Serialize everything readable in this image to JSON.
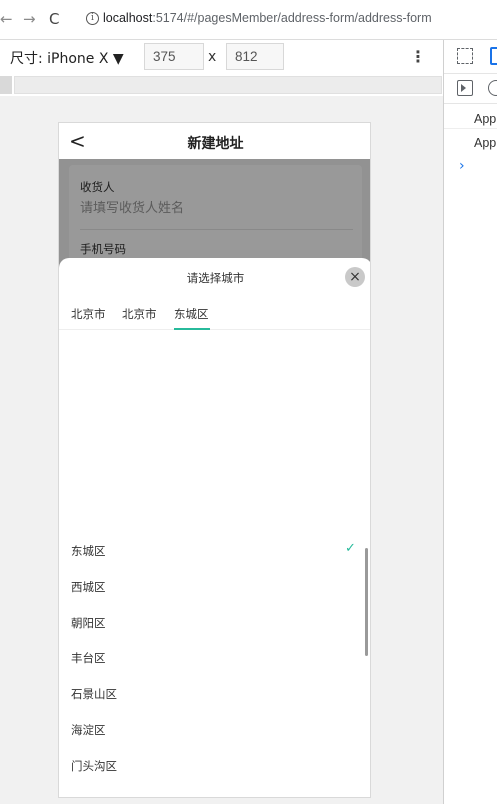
{
  "browser": {
    "back_glyph": "←",
    "forward_glyph": "→",
    "reload_glyph": "C",
    "info_glyph": "i",
    "url_host": "localhost",
    "url_path": ":5174/#/pagesMember/address-form/address-form"
  },
  "device_toolbar": {
    "dimension_label": "尺寸: iPhone X ▼",
    "width": "375",
    "times": "x",
    "height": "812",
    "more_glyph": "⋮"
  },
  "devtools": {
    "rows": [
      "App",
      "App"
    ],
    "expand_glyph": "›"
  },
  "page": {
    "back_glyph": "<",
    "title": "新建地址",
    "form": {
      "receiver_label": "收货人",
      "receiver_placeholder": "请填写收货人姓名",
      "phone_label": "手机号码"
    }
  },
  "city_picker": {
    "title": "请选择城市",
    "close_glyph": "×",
    "tabs": [
      "北京市",
      "北京市",
      "东城区"
    ],
    "options": [
      "东城区",
      "西城区",
      "朝阳区",
      "丰台区",
      "石景山区",
      "海淀区",
      "门头沟区"
    ],
    "selected_index": 0,
    "check_glyph": "✓",
    "accent_color": "#27ba9b"
  }
}
